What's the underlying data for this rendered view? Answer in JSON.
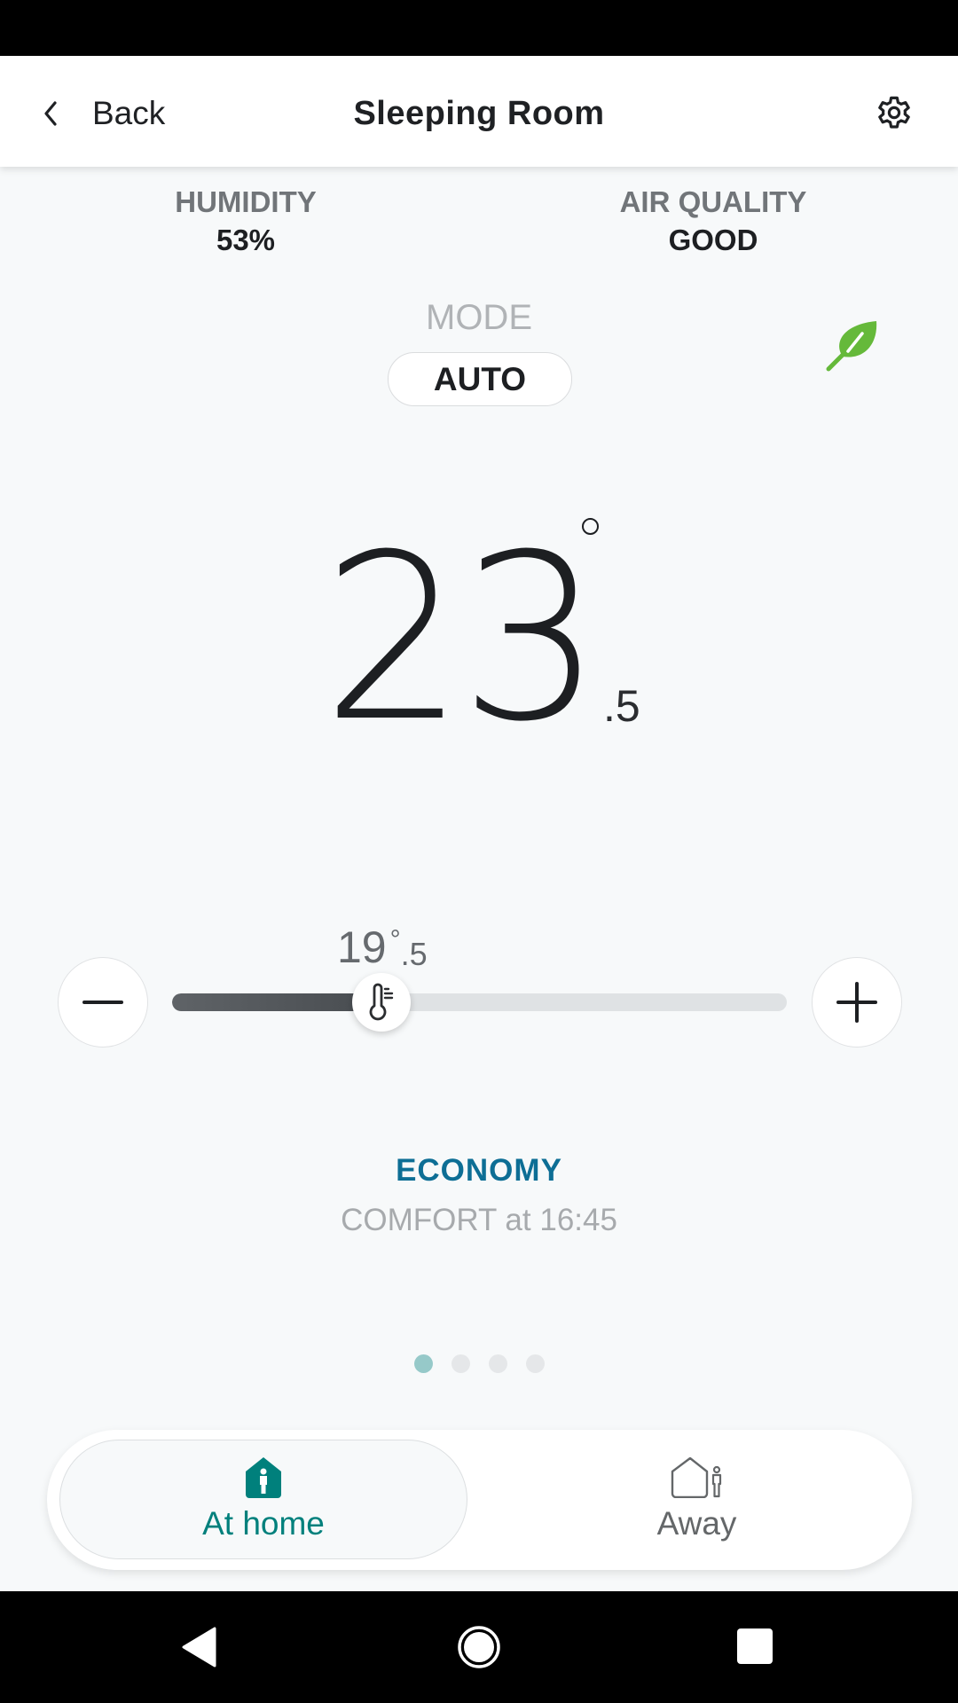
{
  "header": {
    "back_label": "Back",
    "title": "Sleeping Room",
    "settings_icon": "gear-icon"
  },
  "stats": {
    "humidity": {
      "label": "HUMIDITY",
      "value": "53%"
    },
    "air_quality": {
      "label": "AIR QUALITY",
      "value": "GOOD"
    }
  },
  "mode": {
    "label": "MODE",
    "value": "AUTO",
    "eco_icon": "leaf-icon",
    "eco_color": "#65b93a"
  },
  "current_temperature": {
    "integer": "23",
    "decimal": ".5",
    "unit_symbol": "°"
  },
  "setpoint": {
    "integer": "19",
    "degree": "°",
    "decimal": ".5",
    "slider_fraction": 0.34,
    "decrease_icon": "minus-icon",
    "increase_icon": "plus-icon",
    "thumb_icon": "thermometer-icon"
  },
  "schedule": {
    "current_mode": "ECONOMY",
    "next_change": "COMFORT at 16:45",
    "current_mode_color": "#0d6e95"
  },
  "pager": {
    "count": 4,
    "active_index": 0
  },
  "presence": {
    "options": [
      {
        "label": "At home",
        "icon": "home-person-icon",
        "selected": true,
        "color": "#00807c"
      },
      {
        "label": "Away",
        "icon": "away-person-icon",
        "selected": false,
        "color": "#646769"
      }
    ]
  },
  "system_nav": {
    "back": "nav-back-icon",
    "home": "nav-home-icon",
    "recents": "nav-recents-icon"
  }
}
